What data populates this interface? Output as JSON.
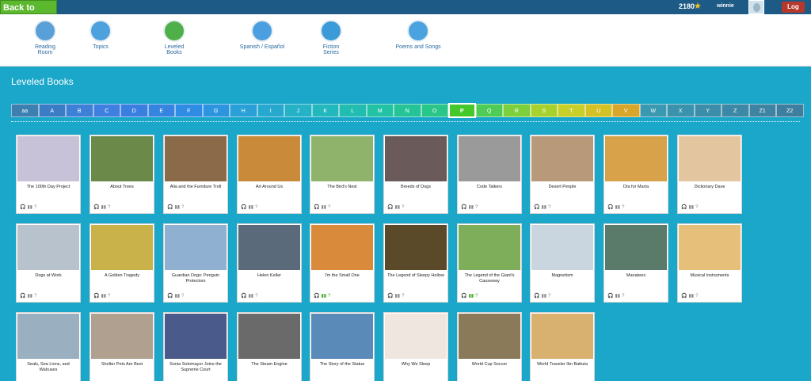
{
  "topbar": {
    "back_label": "Back to Reading",
    "points": "2180",
    "star_icon": "star-icon",
    "username": "winnie",
    "logout_label": "Log Out"
  },
  "nav": [
    {
      "label": "Reading\nRoom",
      "icon": "reading-room-icon",
      "color": "#5aa0d8"
    },
    {
      "label": "Topics",
      "icon": "topics-icon",
      "color": "#4da1dc"
    },
    {
      "label": "Leveled Books",
      "icon": "leveled-books-icon",
      "color": "#4fb04a"
    },
    {
      "label": "Spanish / Español",
      "icon": "spanish-icon",
      "color": "#4b9fe0"
    },
    {
      "label": "Fiction Series",
      "icon": "fiction-series-icon",
      "color": "#3a9bd8"
    },
    {
      "label": "Poems and Songs",
      "icon": "poems-songs-icon",
      "color": "#4aa3df"
    }
  ],
  "section_title": "Leveled Books",
  "levels": [
    "aa",
    "A",
    "B",
    "C",
    "D",
    "E",
    "F",
    "G",
    "H",
    "I",
    "J",
    "K",
    "L",
    "M",
    "N",
    "O",
    "P",
    "Q",
    "R",
    "S",
    "T",
    "U",
    "V",
    "W",
    "X",
    "Y",
    "Z",
    "Z1",
    "Z2"
  ],
  "selected_level": "P",
  "books": [
    {
      "title": "The 100th Day Project",
      "green": false
    },
    {
      "title": "About Trees",
      "green": false
    },
    {
      "title": "Alia and the Furniture Troll",
      "green": false
    },
    {
      "title": "Art Around Us",
      "green": false
    },
    {
      "title": "The Bird's Nest",
      "green": false
    },
    {
      "title": "Breeds of Dogs",
      "green": false
    },
    {
      "title": "Code Talkers",
      "green": false
    },
    {
      "title": "Desert People",
      "green": false
    },
    {
      "title": "Día for María",
      "green": false
    },
    {
      "title": "Dictionary Dave",
      "green": false
    },
    {
      "title": "Dogs at Work",
      "green": false
    },
    {
      "title": "A Golden Tragedy",
      "green": false
    },
    {
      "title": "Guardian Dogs: Penguin Protectors",
      "green": false
    },
    {
      "title": "Helen Keller",
      "green": false
    },
    {
      "title": "I'm the Small One",
      "green": true
    },
    {
      "title": "The Legend of Sleepy Hollow",
      "green": false
    },
    {
      "title": "The Legend of the Giant's Causeway",
      "green": true
    },
    {
      "title": "Magnetism",
      "green": false
    },
    {
      "title": "Manatees",
      "green": false
    },
    {
      "title": "Musical Instruments",
      "green": false
    },
    {
      "title": "Seals, Sea Lions, and Walruses",
      "green": false
    },
    {
      "title": "Shelter Pets Are Best",
      "green": false
    },
    {
      "title": "Sonia Sotomayor Joins the Supreme Court",
      "green": false
    },
    {
      "title": "The Steam Engine",
      "green": false
    },
    {
      "title": "The Story of the Statue",
      "green": false
    },
    {
      "title": "Why We Sleep",
      "green": false
    },
    {
      "title": "World Cup Soccer",
      "green": false
    },
    {
      "title": "World Traveler Ibn Battuta",
      "green": false
    }
  ],
  "book_icons": {
    "listen": "headphones-icon",
    "read": "book-icon",
    "quiz": "question-icon"
  }
}
